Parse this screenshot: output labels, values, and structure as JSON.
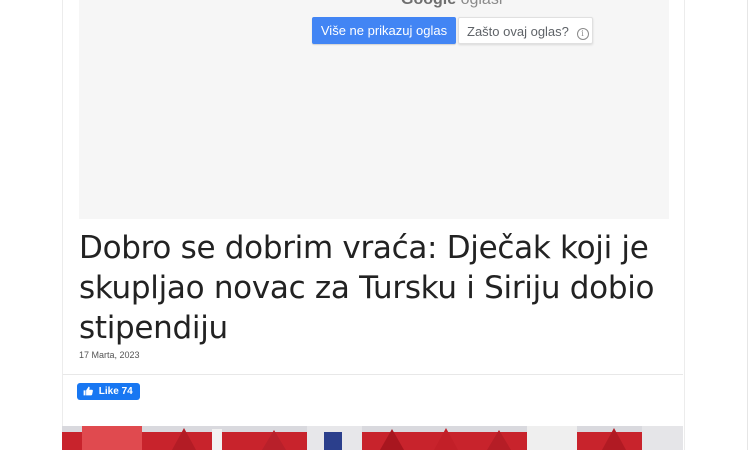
{
  "ad": {
    "brand_google": "Google",
    "brand_suffix": "oglasi",
    "stop_button": "Više ne prikazuj oglas",
    "why_button": "Zašto ovaj oglas?",
    "info_symbol": "i"
  },
  "article": {
    "title": "Dobro se dobrim vraća: Dječak koji je skupljao novac za Tursku i Siriju dobio stipendiju",
    "date": "17 Marta, 2023"
  },
  "social": {
    "like_label": "Like",
    "like_count": "74"
  },
  "colors": {
    "ad_primary": "#4285f4",
    "facebook": "#1877f2",
    "hero_red": "#c8232c"
  },
  "icons": {
    "like": "thumbs-up-icon",
    "info": "info-icon"
  }
}
